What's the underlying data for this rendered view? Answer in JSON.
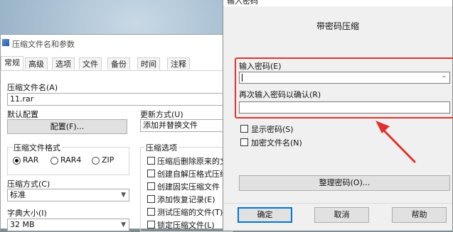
{
  "back_window": {
    "title": "压缩文件名和参数",
    "tabs": [
      "常规",
      "高级",
      "选项",
      "文件",
      "备份",
      "时间",
      "注释"
    ],
    "archive_name_label": "压缩文件名(A)",
    "archive_name_value": "11.rar",
    "default_config_label": "默认配置",
    "config_button": "配置(F)...",
    "update_mode_label": "更新方式(U)",
    "update_mode_value": "添加并替换文件",
    "format_group_label": "压缩文件格式",
    "formats": [
      "RAR",
      "RAR4",
      "ZIP"
    ],
    "selected_format": "RAR",
    "options_group_label": "压缩选项",
    "options": [
      "压缩后删除原来的文",
      "创建自解压格式压缩",
      "创建固实压缩文件",
      "添加恢复记录(E)",
      "测试压缩的文件(T)",
      "锁定压缩文件(L)"
    ],
    "method_label": "压缩方式(C)",
    "method_value": "标准",
    "dict_label": "字典大小(I)",
    "dict_value": "32 MB"
  },
  "dialog": {
    "title": "输入密码",
    "heading": "带密码压缩",
    "enter_password_label": "输入密码(E)",
    "reenter_password_label": "再次输入密码以确认(R)",
    "password_value": "",
    "confirm_value": "",
    "show_password_label": "显示密码(S)",
    "encrypt_filenames_label": "加密文件名(N)",
    "organize_button": "整理密码(O)...",
    "ok_button": "确定",
    "cancel_button": "取消",
    "help_button": "帮助"
  },
  "colors": {
    "highlight": "#e0322c",
    "default_button_border": "#0078d7"
  }
}
